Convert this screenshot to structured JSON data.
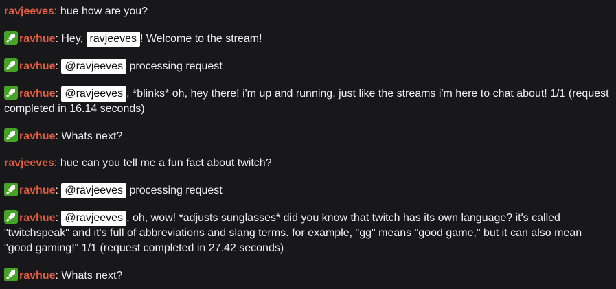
{
  "chat": {
    "messages": [
      {
        "user": "ravjeeves",
        "sep": ": ",
        "text": "hue how are you?"
      },
      {
        "badge": "sword-icon",
        "user": "ravhue",
        "sep": ": ",
        "pre": "Hey, ",
        "mention": "ravjeeves",
        "post": "! Welcome to the stream!"
      },
      {
        "badge": "sword-icon",
        "user": "ravhue",
        "sep": ": ",
        "mention": "@ravjeeves",
        "post": " processing request"
      },
      {
        "badge": "sword-icon",
        "user": "ravhue",
        "sep": ": ",
        "mention": "@ravjeeves",
        "post": ", *blinks* oh, hey there! i'm up and running, just like the streams i'm here to chat about! 1/1 (request completed in 16.14 seconds)"
      },
      {
        "badge": "sword-icon",
        "user": "ravhue",
        "sep": ": ",
        "text": "Whats next?"
      },
      {
        "user": "ravjeeves",
        "sep": ": ",
        "text": "hue can you tell me a fun fact about twitch?"
      },
      {
        "badge": "sword-icon",
        "user": "ravhue",
        "sep": ": ",
        "mention": "@ravjeeves",
        "post": " processing request"
      },
      {
        "badge": "sword-icon",
        "user": "ravhue",
        "sep": ": ",
        "mention": "@ravjeeves",
        "post": ", oh, wow! *adjusts sunglasses* did you know that twitch has its own language? it's called \"twitchspeak\" and it's full of abbreviations and slang terms. for example, \"gg\" means \"good game,\" but it can also mean \"good gaming!\" 1/1 (request completed in 27.42 seconds)"
      },
      {
        "badge": "sword-icon",
        "user": "ravhue",
        "sep": ": ",
        "text": "Whats next?"
      }
    ]
  },
  "colors": {
    "background": "#18181b",
    "text": "#efeff1",
    "username": "#e05b3f",
    "badge": "#45a325",
    "mention_bg": "#ffffff",
    "mention_text": "#0e0e10"
  }
}
